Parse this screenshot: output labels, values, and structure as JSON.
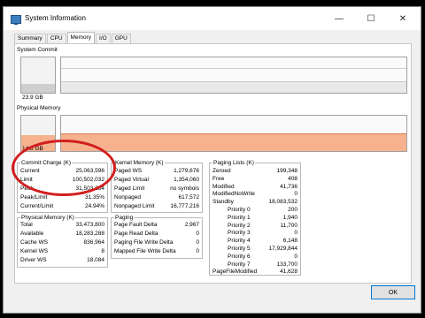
{
  "window": {
    "title": "System Information"
  },
  "caption": {
    "minimize": "—",
    "maximize": "☐",
    "close": "✕"
  },
  "tabs": [
    "Summary",
    "CPU",
    "Memory",
    "I/O",
    "GPU"
  ],
  "graphs": {
    "commit": {
      "label": "System Commit",
      "value": "23.9 GB",
      "level": 0.24
    },
    "physical": {
      "label": "Physical Memory",
      "value": "14.6 GB",
      "level": 0.44
    },
    "physical_fill_color": "#f6b28f",
    "graph_line_color": "#d8d8d8"
  },
  "commit_charge": {
    "title": "Commit Charge (K)",
    "rows": [
      {
        "label": "Current",
        "value": "25,063,596"
      },
      {
        "label": "Limit",
        "value": "100,502,032"
      },
      {
        "label": "Peak",
        "value": "31,503,284"
      },
      {
        "label": "Peak/Limit",
        "value": "31.35%"
      },
      {
        "label": "Current/Limit",
        "value": "24.94%"
      }
    ]
  },
  "physical_memory": {
    "title": "Physical Memory (K)",
    "rows": [
      {
        "label": "Total",
        "value": "33,473,800"
      },
      {
        "label": "Available",
        "value": "18,283,288"
      },
      {
        "label": "Cache WS",
        "value": "836,964"
      },
      {
        "label": "Kernel WS",
        "value": "8"
      },
      {
        "label": "Driver WS",
        "value": "18,084"
      }
    ]
  },
  "kernel_memory": {
    "title": "Kernel Memory (K)",
    "rows": [
      {
        "label": "Paged WS",
        "value": "1,279,676"
      },
      {
        "label": "Paged Virtual",
        "value": "1,354,060"
      },
      {
        "label": "Paged Limit",
        "value": "no symbols"
      },
      {
        "label": "Nonpaged",
        "value": "617,572"
      },
      {
        "label": "Nonpaged Limit",
        "value": "16,777,216"
      }
    ]
  },
  "paging": {
    "title": "Paging",
    "rows": [
      {
        "label": "Page Fault Delta",
        "value": "2,967"
      },
      {
        "label": "Page Read Delta",
        "value": "0"
      },
      {
        "label": "Paging File Write Delta",
        "value": "0"
      },
      {
        "label": "Mapped File Write Delta",
        "value": "0"
      }
    ]
  },
  "paging_lists": {
    "title": "Paging Lists (K)",
    "rows": [
      {
        "label": "Zeroed",
        "value": "199,348"
      },
      {
        "label": "Free",
        "value": "408"
      },
      {
        "label": "Modified",
        "value": "41,736"
      },
      {
        "label": "ModifiedNoWrite",
        "value": "0"
      },
      {
        "label": "Standby",
        "value": "18,083,532"
      },
      {
        "label": "Priority 0",
        "value": "200"
      },
      {
        "label": "Priority 1",
        "value": "1,940"
      },
      {
        "label": "Priority 2",
        "value": "11,700"
      },
      {
        "label": "Priority 3",
        "value": "0"
      },
      {
        "label": "Priority 4",
        "value": "6,148"
      },
      {
        "label": "Priority 5",
        "value": "17,929,844"
      },
      {
        "label": "Priority 6",
        "value": "0"
      },
      {
        "label": "Priority 7",
        "value": "133,700"
      },
      {
        "label": "PageFileModified",
        "value": "41,628"
      }
    ]
  },
  "ok_button": "OK",
  "annotation_color": "#d21e1e"
}
